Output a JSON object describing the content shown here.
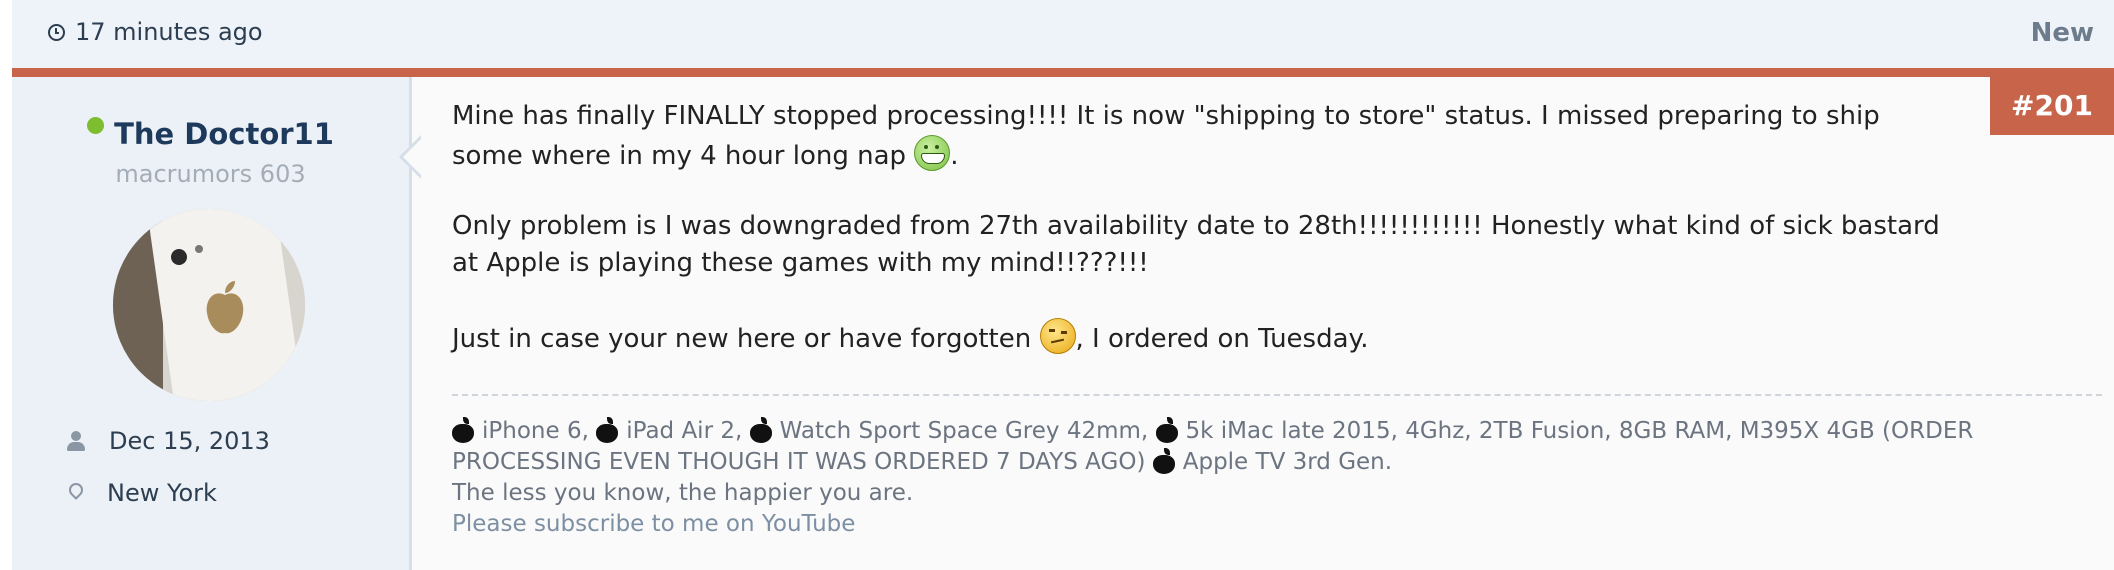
{
  "header": {
    "time_ago": "17 minutes ago",
    "new_label": "New"
  },
  "post": {
    "number": "#201",
    "paragraph_1a": "Mine has finally FINALLY stopped processing!!!! It is now \"shipping to store\" status. I missed preparing to ship",
    "paragraph_1b": "some where in my 4 hour long nap",
    "paragraph_1c": ".",
    "paragraph_2a": "Only problem is I was downgraded from 27th availability date to 28th!!!!!!!!!!!! Honestly what kind of sick bastard",
    "paragraph_2b": "at Apple is playing these games with my mind!!???!!!",
    "paragraph_3a": "Just in case your new here or have forgotten",
    "paragraph_3b": ", I ordered on Tuesday."
  },
  "user": {
    "name": "The Doctor11",
    "title": "macrumors 603",
    "joined": "Dec 15, 2013",
    "location": "New York"
  },
  "signature": {
    "devices": [
      "iPhone 6,",
      "iPad Air 2,",
      "Watch Sport Space Grey 42mm,",
      "5k iMac late 2015, 4Ghz, 2TB Fusion, 8GB RAM, M395X 4GB (ORDER",
      "PROCESSING EVEN THOUGH IT WAS ORDERED 7 DAYS AGO)",
      "Apple TV 3rd Gen."
    ],
    "tagline": "The less you know, the happier you are.",
    "link": "Please subscribe to me on YouTube"
  },
  "colors": {
    "accent": "#c8644a",
    "online": "#7cbe2f",
    "username": "#1d3a5c"
  },
  "icons": [
    "clock-icon",
    "person-icon",
    "map-pin-icon",
    "apple-icon",
    "grin-smiley-icon",
    "thinking-smiley-icon"
  ]
}
